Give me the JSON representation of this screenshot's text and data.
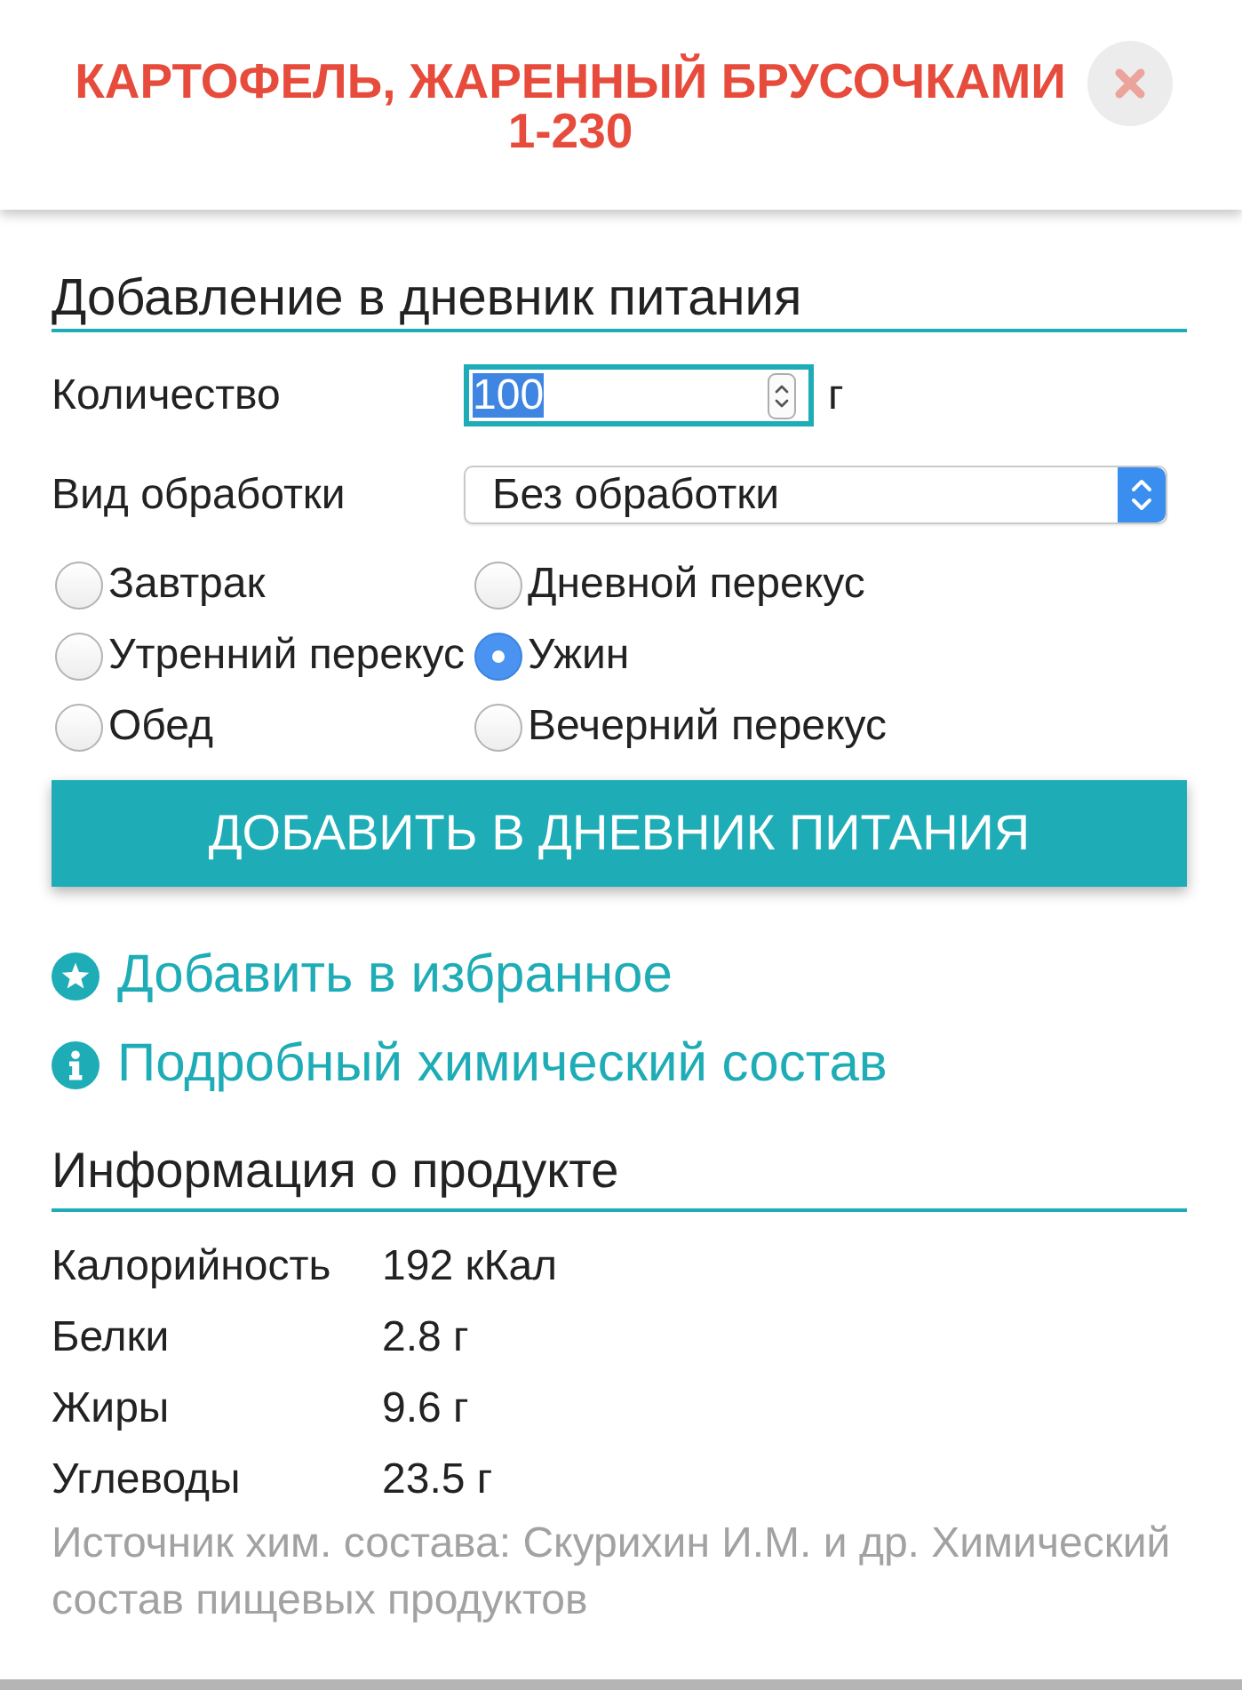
{
  "dialog": {
    "title": "КАРТОФЕЛЬ, ЖАРЕННЫЙ БРУСОЧКАМИ 1-230"
  },
  "add_to_diary": {
    "heading": "Добавление в дневник питания",
    "quantity": {
      "label": "Количество",
      "value": "100",
      "unit": "г",
      "focused": true,
      "value_selected": true
    },
    "processing": {
      "label": "Вид обработки",
      "value": "Без обработки"
    },
    "meals": [
      {
        "label": "Завтрак",
        "selected": false
      },
      {
        "label": "Утренний перекус",
        "selected": false
      },
      {
        "label": "Обед",
        "selected": false
      },
      {
        "label": "Дневной перекус",
        "selected": false
      },
      {
        "label": "Ужин",
        "selected": true
      },
      {
        "label": "Вечерний перекус",
        "selected": false
      }
    ],
    "submit_button": "ДОБАВИТЬ В ДНЕВНИК ПИТАНИЯ"
  },
  "links": [
    {
      "label": "Добавить в избранное",
      "kind": "favorite"
    },
    {
      "label": "Подробный химический состав",
      "kind": "info"
    }
  ],
  "product_info": {
    "heading": "Информация о продукте",
    "rows": [
      {
        "name": "Калорийность",
        "value": "192 кКал"
      },
      {
        "name": "Белки",
        "value": "2.8 г"
      },
      {
        "name": "Жиры",
        "value": "9.6 г"
      },
      {
        "name": "Углеводы",
        "value": "23.5 г"
      }
    ],
    "source_note": "Источник хим. состава: Скурихин И.М. и др. Химический состав пищевых продуктов"
  }
}
